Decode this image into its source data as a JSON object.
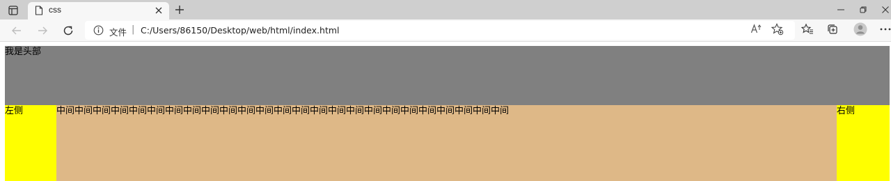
{
  "browser": {
    "tab": {
      "title": "css"
    },
    "address": {
      "scheme_label": "文件",
      "separator": "|",
      "url": "C:/Users/86150/Desktop/web/html/index.html"
    },
    "icons": [
      "tab-actions-icon",
      "file-icon",
      "close-icon",
      "plus-icon",
      "minimize-icon",
      "restore-icon",
      "close-window-icon",
      "back-icon",
      "forward-icon",
      "refresh-icon",
      "info-icon",
      "read-aloud-icon",
      "add-favorite-icon",
      "favorites-icon",
      "collections-icon",
      "profile-icon",
      "more-icon"
    ]
  },
  "page": {
    "header_text": "我是头部",
    "left_text": "左侧",
    "center_text": "中间中间中间中间中间中间中间中间中间中间中间中间中间中间中间中间中间中间中间中间中间中间中间中间中间",
    "right_text": "右侧",
    "colors": {
      "header": "#808080",
      "side": "#ffff00",
      "center": "#deb887"
    }
  }
}
